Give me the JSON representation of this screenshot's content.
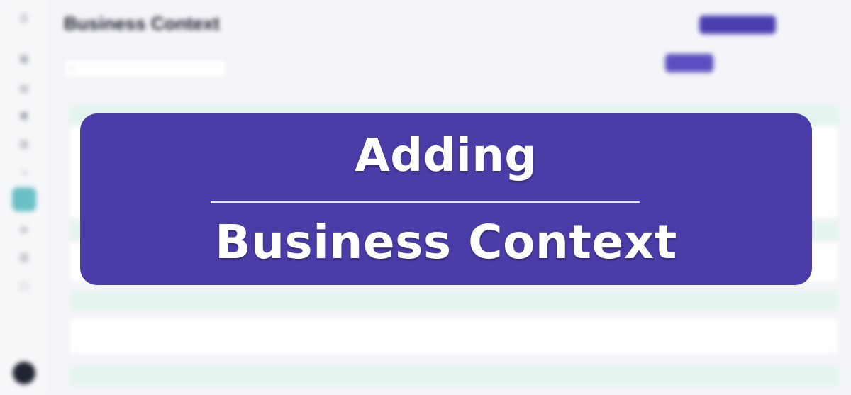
{
  "banner": {
    "line1": "Adding",
    "line2": "Business Context"
  },
  "page": {
    "title": "Business Context"
  },
  "colors": {
    "banner_bg": "#4b3da8",
    "accent": "#5a4fc0",
    "active_nav": "#6bbfc7",
    "card_header": "#e4f3ee"
  },
  "sidebar": {
    "icons": [
      "menu-icon",
      "dashboard-icon",
      "chart-icon",
      "grid-icon",
      "table-icon",
      "code-icon",
      "context-icon",
      "settings-icon",
      "database-icon",
      "help-icon"
    ],
    "active_item": "context-icon"
  }
}
